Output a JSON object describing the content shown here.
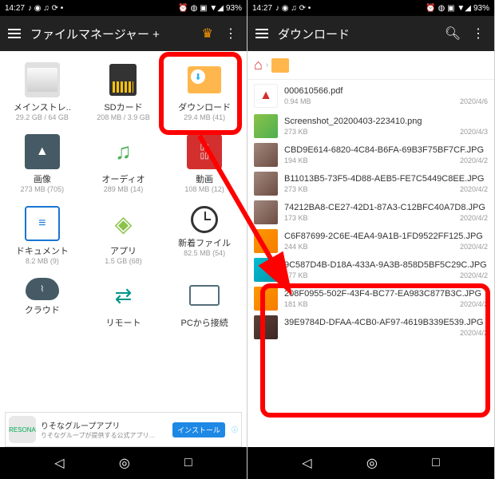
{
  "status": {
    "time": "14:27",
    "battery": "93%"
  },
  "left": {
    "appbar": {
      "title": "ファイルマネージャー +"
    },
    "grid": [
      {
        "label": "メインストレ..",
        "sub": "29.2 GB / 64 GB"
      },
      {
        "label": "SDカード",
        "sub": "208 MB / 3.9 GB"
      },
      {
        "label": "ダウンロード",
        "sub": "29.4 MB (41)"
      },
      {
        "label": "画像",
        "sub": "273 MB (705)"
      },
      {
        "label": "オーディオ",
        "sub": "289 MB (14)"
      },
      {
        "label": "動画",
        "sub": "108 MB (12)"
      },
      {
        "label": "ドキュメント",
        "sub": "8.2 MB (9)"
      },
      {
        "label": "アプリ",
        "sub": "1.5 GB (68)"
      },
      {
        "label": "新着ファイル",
        "sub": "82.5 MB (54)"
      },
      {
        "label": "クラウド",
        "sub": ""
      },
      {
        "label": "リモート",
        "sub": ""
      },
      {
        "label": "PCから接続",
        "sub": ""
      }
    ],
    "ad": {
      "title": "りそなグループアプリ",
      "sub": "りそなグループが提供する公式アプリ…",
      "btn": "インストール"
    }
  },
  "right": {
    "appbar": {
      "title": "ダウンロード"
    },
    "files": [
      {
        "name": "000610566.pdf",
        "size": "0.94 MB",
        "date": "2020/4/6",
        "type": "pdf"
      },
      {
        "name": "Screenshot_20200403-223410.png",
        "size": "273 KB",
        "date": "2020/4/3",
        "type": "img"
      },
      {
        "name": "CBD9E614-6820-4C84-B6FA-69B3F75BF7CF.JPG",
        "size": "194 KB",
        "date": "2020/4/2",
        "type": "img2"
      },
      {
        "name": "B11013B5-73F5-4D88-AEB5-FE7C5449C8EE.JPG",
        "size": "273 KB",
        "date": "2020/4/2",
        "type": "img2"
      },
      {
        "name": "74212BA8-CE27-42D1-87A3-C12BFC40A7D8.JPG",
        "size": "173 KB",
        "date": "2020/4/2",
        "type": "img2"
      },
      {
        "name": "C6F87699-2C6E-4EA4-9A1B-1FD9522FF125.JPG",
        "size": "244 KB",
        "date": "2020/4/2",
        "type": "img4"
      },
      {
        "name": "9C587D4B-D18A-433A-9A3B-858D5BF5C29C.JPG",
        "size": "277 KB",
        "date": "2020/4/2",
        "type": "img3"
      },
      {
        "name": "208F0955-502F-43F4-BC77-EA983C877B3C.JPG",
        "size": "181 KB",
        "date": "2020/4/2",
        "type": "img4"
      },
      {
        "name": "39E9784D-DFAA-4CB0-AF97-4619B339E539.JPG",
        "size": "",
        "date": "2020/4/2",
        "type": "img5"
      }
    ]
  }
}
